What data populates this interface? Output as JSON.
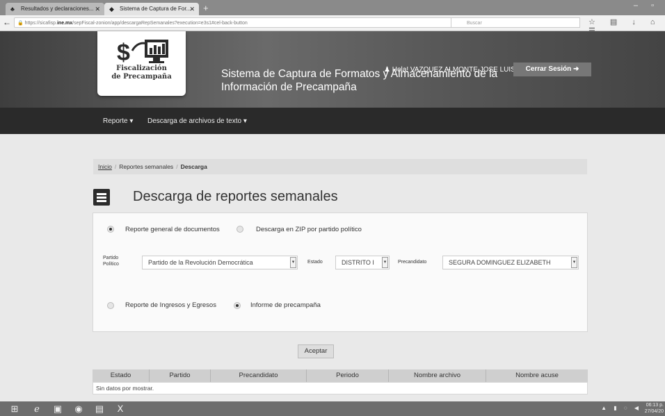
{
  "browser": {
    "tabs": [
      {
        "label": "Resultados y declaraciones..."
      },
      {
        "label": "Sistema de Captura de For..."
      }
    ],
    "url_prefix": "https://sicafisp.",
    "url_domain": "ine.mx",
    "url_rest": "/sepFiscal-zonion/app/descargaRepSemanales?execution=e3s1#cel-back-button",
    "search_placeholder": "Buscar"
  },
  "header": {
    "logo_line1": "Fiscalización",
    "logo_line2": "de Precampaña",
    "title_line1": "Sistema de Captura de Formatos y Almacenamiento de la",
    "title_line2": "Información de Precampaña",
    "greeting": "Hola! VAZQUEZ ALMONTE JOSE LUIS",
    "logout": "Cerrar Sesión"
  },
  "menu": {
    "items": [
      {
        "label": "Reporte"
      },
      {
        "label": "Descarga de archivos de texto"
      }
    ]
  },
  "breadcrumb": {
    "items": [
      "Inicio",
      "Reportes semanales",
      "Descarga"
    ]
  },
  "page": {
    "title": "Descarga de reportes semanales"
  },
  "form": {
    "radio_general": "Reporte general de documentos",
    "radio_zip": "Descarga en ZIP por partido político",
    "partido_label_1": "Partido",
    "partido_label_2": "Político",
    "partido_value": "Partido de la Revolución Democrática",
    "estado_label": "Estado",
    "estado_value": "DISTRITO I",
    "precandidato_label": "Precandidato",
    "precandidato_value": "SEGURA DOMINGUEZ ELIZABETH",
    "radio_ingresos": "Reporte de Ingresos y Egresos",
    "radio_informe": "Informe de precampaña",
    "accept": "Aceptar"
  },
  "table": {
    "columns": [
      "Estado",
      "Partido",
      "Precandidato",
      "Periodo",
      "Nombre archivo",
      "Nombre acuse"
    ],
    "empty_message": "Sin datos por mostrar."
  },
  "taskbar": {
    "time": "06:13 p.",
    "date": "27/04/20"
  }
}
